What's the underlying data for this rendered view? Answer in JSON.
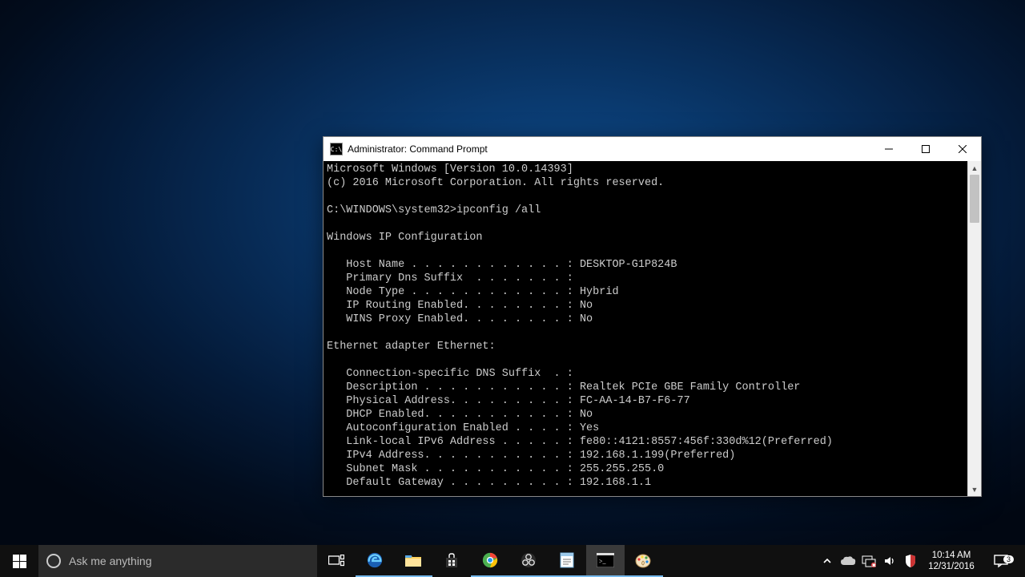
{
  "window": {
    "title": "Administrator: Command Prompt"
  },
  "console": {
    "lines": [
      "Microsoft Windows [Version 10.0.14393]",
      "(c) 2016 Microsoft Corporation. All rights reserved.",
      "",
      "C:\\WINDOWS\\system32>ipconfig /all",
      "",
      "Windows IP Configuration",
      "",
      "   Host Name . . . . . . . . . . . . : DESKTOP-G1P824B",
      "   Primary Dns Suffix  . . . . . . . :",
      "   Node Type . . . . . . . . . . . . : Hybrid",
      "   IP Routing Enabled. . . . . . . . : No",
      "   WINS Proxy Enabled. . . . . . . . : No",
      "",
      "Ethernet adapter Ethernet:",
      "",
      "   Connection-specific DNS Suffix  . :",
      "   Description . . . . . . . . . . . : Realtek PCIe GBE Family Controller",
      "   Physical Address. . . . . . . . . : FC-AA-14-B7-F6-77",
      "   DHCP Enabled. . . . . . . . . . . : No",
      "   Autoconfiguration Enabled . . . . : Yes",
      "   Link-local IPv6 Address . . . . . : fe80::4121:8557:456f:330d%12(Preferred)",
      "   IPv4 Address. . . . . . . . . . . : 192.168.1.199(Preferred)",
      "   Subnet Mask . . . . . . . . . . . : 255.255.255.0",
      "   Default Gateway . . . . . . . . . : 192.168.1.1"
    ]
  },
  "taskbar": {
    "search_placeholder": "Ask me anything",
    "time": "10:14 AM",
    "date": "12/31/2016",
    "notification_count": "3"
  }
}
